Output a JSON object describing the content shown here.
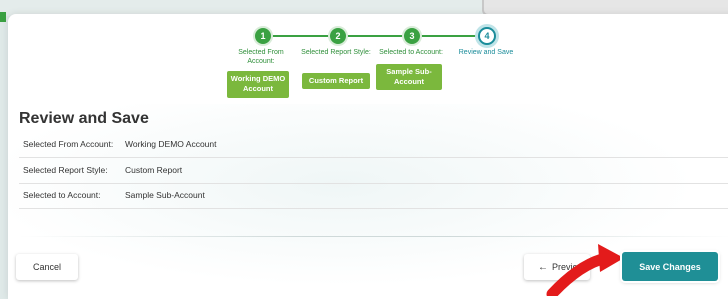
{
  "steps": [
    {
      "number": "1",
      "label": "Selected From Account:",
      "selection": "Working DEMO Account"
    },
    {
      "number": "2",
      "label": "Selected Report Style:",
      "selection": "Custom Report"
    },
    {
      "number": "3",
      "label": "Selected to Account:",
      "selection": "Sample Sub-Account"
    },
    {
      "number": "4",
      "label": "Review and Save"
    }
  ],
  "review": {
    "title": "Review and Save",
    "rows": [
      {
        "label": "Selected From Account:",
        "value": "Working DEMO Account"
      },
      {
        "label": "Selected Report Style:",
        "value": "Custom Report"
      },
      {
        "label": "Selected to Account:",
        "value": "Sample Sub-Account"
      }
    ]
  },
  "footer": {
    "cancel_label": "Cancel",
    "previous_label": "Previous",
    "save_label": "Save Changes"
  },
  "colors": {
    "step_green": "#3aa142",
    "selection_green": "#7bb83d",
    "active_teal": "#1a8c9a",
    "save_button": "#1f8f96",
    "annotation_arrow": "#e31b1b"
  },
  "icons": {
    "previous": "arrow-left-icon",
    "annotation": "red-pointer-arrow"
  }
}
